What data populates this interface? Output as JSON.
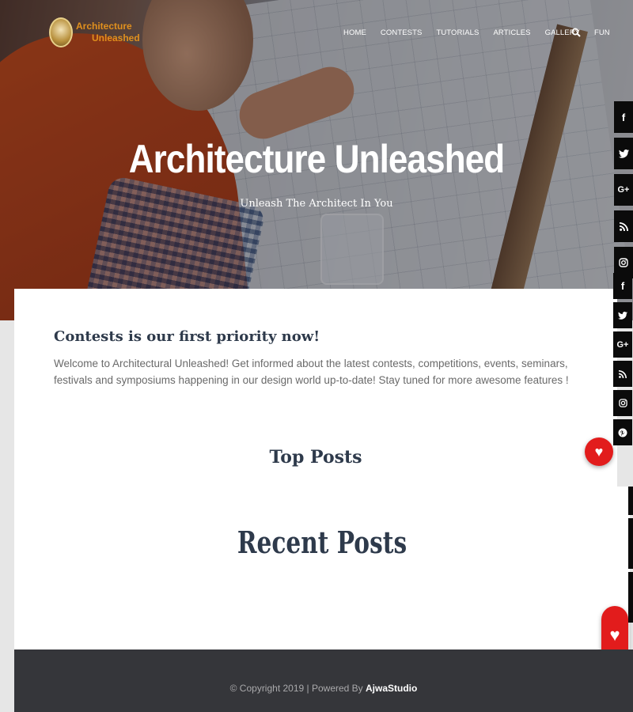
{
  "brand": {
    "line1": "Architecture",
    "line2": "Unleashed"
  },
  "nav": {
    "items": [
      "HOME",
      "CONTESTS",
      "TUTORIALS",
      "ARTICLES",
      "GALLERY",
      "FUN"
    ]
  },
  "hero": {
    "title": "Architecture Unleashed",
    "subtitle": "Unleash The Architect In You"
  },
  "social_top": [
    "f",
    "t",
    "G+",
    "rss",
    "ig"
  ],
  "social_bottom": [
    "f",
    "t",
    "G+",
    "rss",
    "ig",
    "p"
  ],
  "intro": {
    "heading": "Contests is our first priority now!",
    "text": "Welcome to Architectural Unleashed! Get informed about the latest contests, competitions,  events, seminars, festivals and symposiums happening in our design world up-to-date! Stay tuned for more awesome features !"
  },
  "sections": {
    "top_posts": "Top Posts",
    "recent_posts": "Recent Posts"
  },
  "footer": {
    "prefix": "© Copyright 2019 | Powered By",
    "brand": "AjwaStudio"
  },
  "colors": {
    "accent_heart": "#e21c1c",
    "heading": "#2e3a4b",
    "footer_bg": "#35363a",
    "logo": "#e0901e"
  },
  "icons": {
    "search": "search-icon",
    "heart": "heart-icon"
  }
}
